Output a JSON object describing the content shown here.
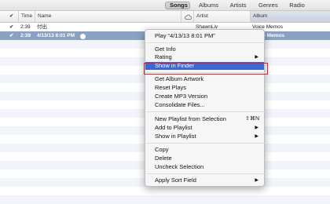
{
  "tabs": [
    {
      "label": "Songs",
      "active": true
    },
    {
      "label": "Albums",
      "active": false
    },
    {
      "label": "Artists",
      "active": false
    },
    {
      "label": "Genres",
      "active": false
    },
    {
      "label": "Radio",
      "active": false
    }
  ],
  "columns": {
    "check": "✔",
    "time": "Time",
    "name": "Name",
    "artist": "Artist",
    "album": "Album"
  },
  "rows": [
    {
      "check": "✔",
      "time": "2:39",
      "name": "付出",
      "artist": "ShawnLiv",
      "album": "Voice Memos",
      "selected": false
    },
    {
      "check": "✔",
      "time": "2:39",
      "name": "4/13/13 8:01 PM",
      "artist": "",
      "album": "Voice Memos",
      "selected": true
    }
  ],
  "menu": {
    "play": "Play “4/13/13 8:01 PM”",
    "get_info": "Get Info",
    "rating": "Rating",
    "show_in_finder": "Show in Finder",
    "get_album_artwork": "Get Album Artwork",
    "reset_plays": "Reset Plays",
    "create_mp3": "Create MP3 Version",
    "consolidate": "Consolidate Files...",
    "new_playlist": "New Playlist from Selection",
    "new_playlist_shortcut": "⇧⌘N",
    "add_to_playlist": "Add to Playlist",
    "show_in_playlist": "Show in Playlist",
    "copy": "Copy",
    "delete": "Delete",
    "uncheck": "Uncheck Selection",
    "apply_sort": "Apply Sort Field",
    "submenu_arrow": "▶"
  },
  "colors": {
    "selection_row": "#8aa1c2",
    "menu_highlight": "#3a68d6",
    "annotation_box": "#e02020"
  }
}
